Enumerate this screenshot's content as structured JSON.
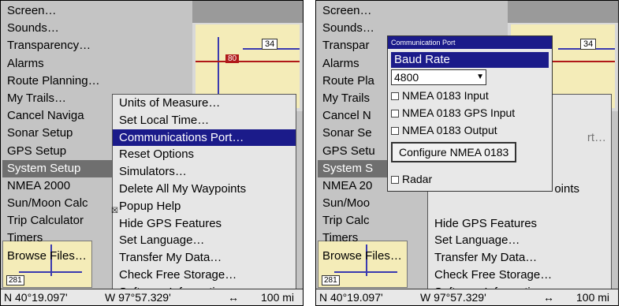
{
  "left": {
    "menu_items": [
      "Screen…",
      "Sounds…",
      "Transparency…",
      "Alarms",
      "Route Planning…",
      "My Trails…",
      "Cancel Naviga",
      "Sonar Setup",
      "GPS Setup",
      "System Setup",
      "NMEA 2000",
      "Sun/Moon Calc",
      "Trip Calculator",
      "Timers",
      "Browse Files…"
    ],
    "submenu_items": [
      "Units of Measure…",
      "Set Local Time…",
      "Communications Port…",
      "Reset Options",
      "Simulators…",
      "Delete All My Waypoints",
      "Popup Help",
      "Hide GPS Features",
      "Set Language…",
      "Transfer My Data…",
      "Check Free Storage…",
      "Software Information…"
    ],
    "map_shield_1": "34",
    "map_shield_2": "80",
    "minimap_label": "281",
    "status": {
      "lat": "N   40°19.097'",
      "lon": "W   97°57.329'",
      "scale_icon": "↔",
      "scale": "100 mi"
    }
  },
  "right": {
    "menu_items": [
      "Screen…",
      "Sounds…",
      "Transpar",
      "Alarms",
      "Route Pla",
      "My Trails",
      "Cancel N",
      "Sonar Se",
      "GPS Setu",
      "System S",
      "NMEA 20",
      "Sun/Moo",
      "Trip Calc",
      "Timers",
      "Browse Files…"
    ],
    "dialog": {
      "title": "Communication Port",
      "baud_label": "Baud Rate",
      "baud_value": "4800",
      "opt1": "NMEA 0183 Input",
      "opt2": "NMEA 0183 GPS Input",
      "opt3": "NMEA 0183 Output",
      "configure_button": "Configure NMEA 0183",
      "radar": "Radar"
    },
    "partial_text": "rt…",
    "partial_text_2": "oints",
    "submenu_items": [
      "Hide GPS Features",
      "Set Language…",
      "Transfer My Data…",
      "Check Free Storage…",
      "Software Information…"
    ],
    "map_shield_1": "34",
    "minimap_label": "281",
    "status": {
      "lat": "N   40°19.097'",
      "lon": "W   97°57.329'",
      "scale_icon": "↔",
      "scale": "100 mi"
    }
  }
}
